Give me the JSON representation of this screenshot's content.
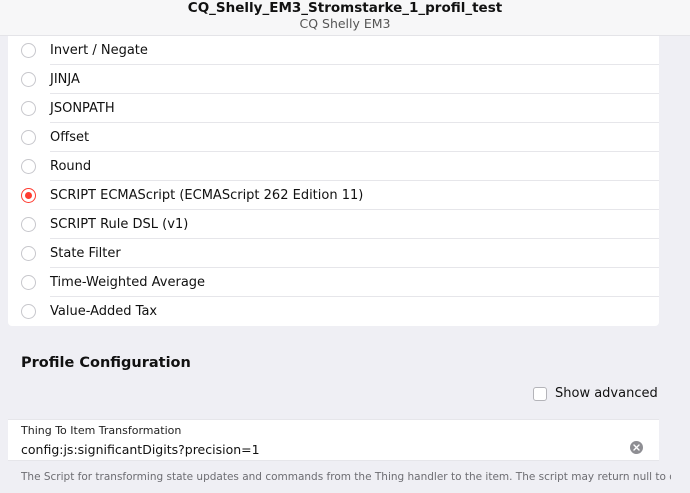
{
  "header": {
    "title": "CQ_Shelly_EM3_Stromstarke_1_profil_test",
    "subtitle": "CQ Shelly EM3"
  },
  "profile_types": [
    {
      "label": "Invert / Negate",
      "selected": false
    },
    {
      "label": "JINJA",
      "selected": false
    },
    {
      "label": "JSONPATH",
      "selected": false
    },
    {
      "label": "Offset",
      "selected": false
    },
    {
      "label": "Round",
      "selected": false
    },
    {
      "label": "SCRIPT ECMAScript (ECMAScript 262 Edition 11)",
      "selected": true
    },
    {
      "label": "SCRIPT Rule DSL (v1)",
      "selected": false
    },
    {
      "label": "State Filter",
      "selected": false
    },
    {
      "label": "Time-Weighted Average",
      "selected": false
    },
    {
      "label": "Value-Added Tax",
      "selected": false
    }
  ],
  "config": {
    "section_title": "Profile Configuration",
    "show_advanced_label": "Show advanced",
    "show_advanced_checked": false,
    "field_label": "Thing To Item Transformation",
    "field_value": "config:js:significantDigits?precision=1",
    "info_text": "The Script for transforming state updates and commands from the Thing handler to the item. The script may return null to discard the"
  },
  "colors": {
    "accent": "#ff3b30",
    "background": "#efeff4"
  }
}
